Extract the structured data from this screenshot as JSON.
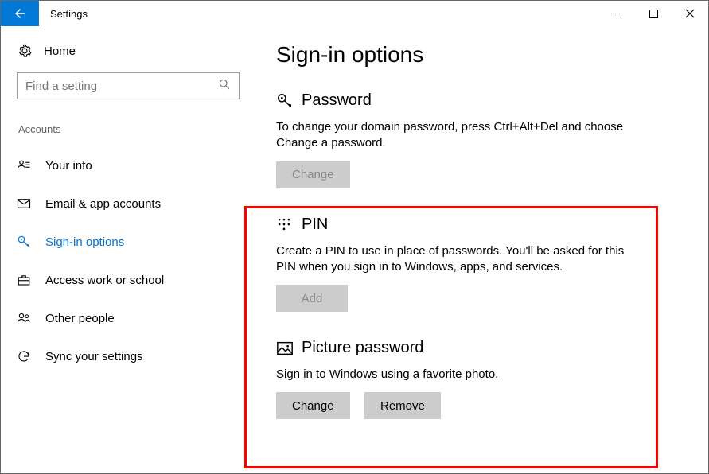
{
  "window": {
    "title": "Settings"
  },
  "sidebar": {
    "home_label": "Home",
    "search_placeholder": "Find a setting",
    "category": "Accounts",
    "items": [
      {
        "label": "Your info"
      },
      {
        "label": "Email & app accounts"
      },
      {
        "label": "Sign-in options"
      },
      {
        "label": "Access work or school"
      },
      {
        "label": "Other people"
      },
      {
        "label": "Sync your settings"
      }
    ]
  },
  "page": {
    "title": "Sign-in options",
    "password": {
      "heading": "Password",
      "description": "To change your domain password, press Ctrl+Alt+Del and choose Change a password.",
      "button": "Change"
    },
    "pin": {
      "heading": "PIN",
      "description": "Create a PIN to use in place of passwords. You'll be asked for this PIN when you sign in to Windows, apps, and services.",
      "button": "Add"
    },
    "picture": {
      "heading": "Picture password",
      "description": "Sign in to Windows using a favorite photo.",
      "button_change": "Change",
      "button_remove": "Remove"
    }
  }
}
